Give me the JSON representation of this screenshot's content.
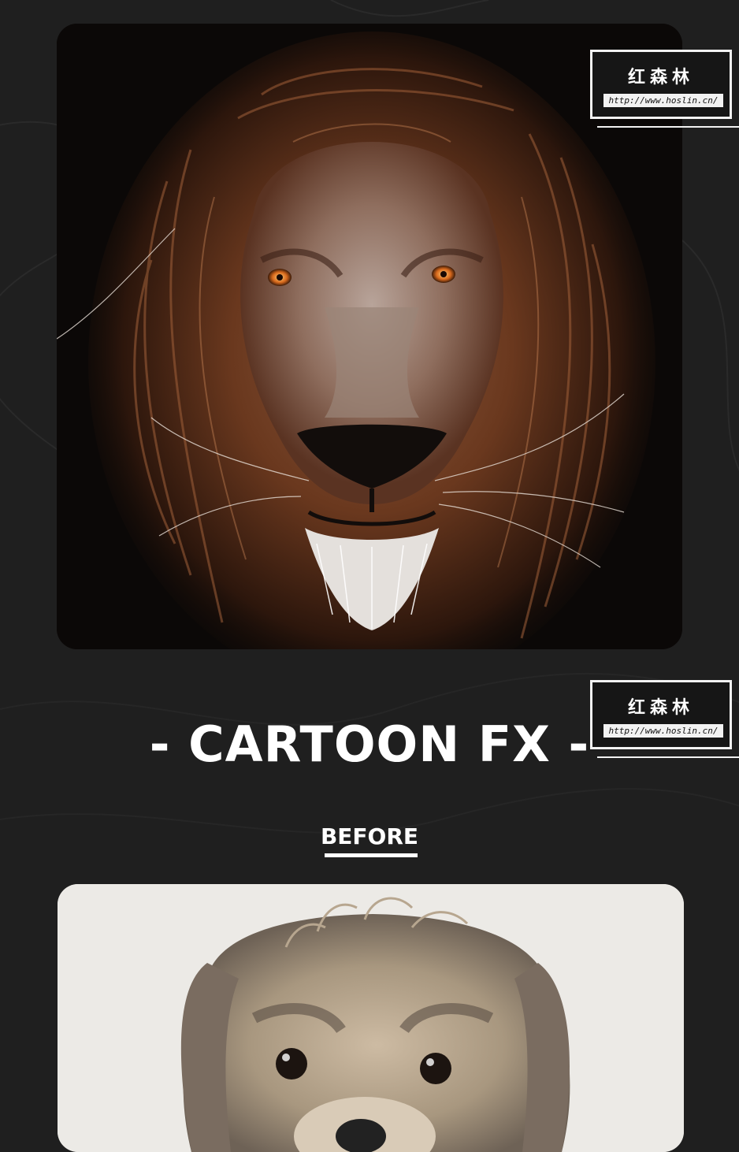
{
  "watermarks": [
    {
      "name": "红森林",
      "url": "http://www.hoslin.cn/"
    },
    {
      "name": "红森林",
      "url": "http://www.hoslin.cn/"
    }
  ],
  "headline": "- CARTOON FX -",
  "before_label": "BEFORE",
  "colors": {
    "background": "#1f1f1f",
    "text": "#ffffff",
    "lion_mane": "#6a3a22",
    "dog_background": "#eceae6"
  },
  "images": [
    {
      "name": "lion-illustration",
      "icon": "lion-portrait"
    },
    {
      "name": "dog-photo",
      "icon": "dog-portrait"
    }
  ]
}
